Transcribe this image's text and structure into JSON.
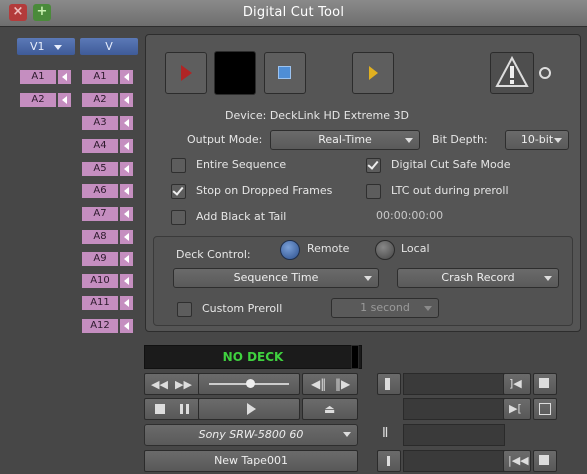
{
  "window": {
    "title": "Digital Cut Tool",
    "close_label": "×",
    "add_label": "+"
  },
  "tracks": {
    "video_record": "V1",
    "video_source": "V",
    "record_audio": [
      "A1",
      "A2"
    ],
    "source_audio": [
      "A1",
      "A2",
      "A3",
      "A4",
      "A5",
      "A6",
      "A7",
      "A8",
      "A9",
      "A10",
      "A11",
      "A12"
    ]
  },
  "device": {
    "label": "Device: DeckLink HD Extreme 3D"
  },
  "output": {
    "mode_label": "Output Mode:",
    "mode_value": "Real-Time",
    "bit_depth_label": "Bit Depth:",
    "bit_depth_value": "10-bit"
  },
  "options": {
    "entire_sequence": "Entire Sequence",
    "stop_on_dropped": "Stop on Dropped Frames",
    "add_black": "Add Black at Tail",
    "digital_cut_safe": "Digital Cut Safe Mode",
    "ltc_out": "LTC out during preroll",
    "black_timecode": "00:00:00:00"
  },
  "deck_control": {
    "label": "Deck Control:",
    "remote": "Remote",
    "local": "Local",
    "time_mode": "Sequence Time",
    "record_mode": "Crash Record",
    "custom_preroll": "Custom Preroll",
    "preroll_value": "1 second"
  },
  "deck": {
    "status": "NO DECK",
    "model": "Sony SRW-5800 60",
    "tape": "New Tape001"
  },
  "colors": {
    "status_green": "#3fd13f",
    "record_red": "#b02525",
    "play_yellow": "#e0b020",
    "track_purple": "#c58ec0",
    "track_blue": "#4a68a8"
  }
}
